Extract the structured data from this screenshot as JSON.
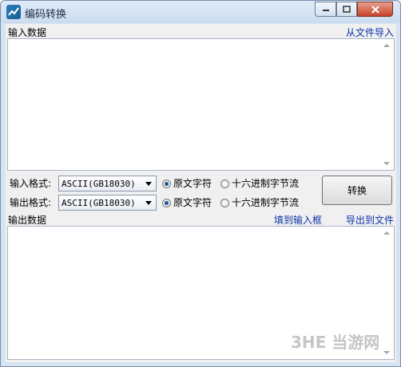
{
  "window": {
    "title": "编码转换"
  },
  "input": {
    "label": "输入数据",
    "import_link": "从文件导入",
    "value": ""
  },
  "input_format": {
    "label": "输入格式:",
    "selected": "ASCII(GB18030)",
    "radio_original": "原文字符",
    "radio_hex": "十六进制字节流",
    "selected_mode": "原文字符"
  },
  "output_format": {
    "label": "输出格式:",
    "selected": "ASCII(GB18030)",
    "radio_original": "原文字符",
    "radio_hex": "十六进制字节流",
    "selected_mode": "原文字符"
  },
  "convert_button": "转换",
  "output": {
    "label": "输出数据",
    "fill_input_link": "填到输入框",
    "export_link": "导出到文件",
    "value": ""
  },
  "watermark": "3HE 当游网"
}
